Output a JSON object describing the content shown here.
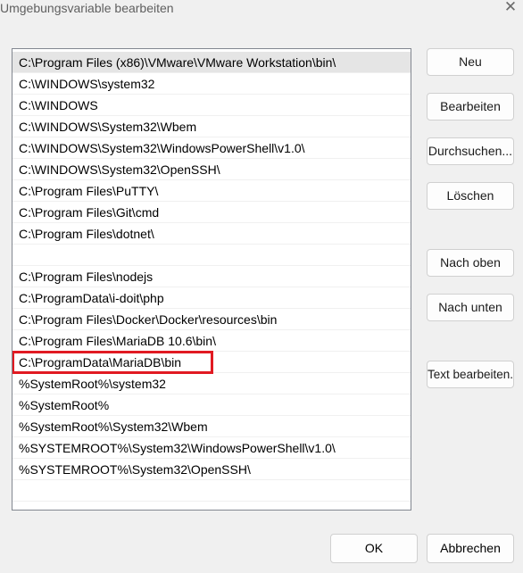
{
  "window": {
    "title": "Umgebungsvariable bearbeiten",
    "close_glyph": "✕"
  },
  "list": {
    "items": [
      "C:\\Program Files (x86)\\VMware\\VMware Workstation\\bin\\",
      "C:\\WINDOWS\\system32",
      "C:\\WINDOWS",
      "C:\\WINDOWS\\System32\\Wbem",
      "C:\\WINDOWS\\System32\\WindowsPowerShell\\v1.0\\",
      "C:\\WINDOWS\\System32\\OpenSSH\\",
      "C:\\Program Files\\PuTTY\\",
      "C:\\Program Files\\Git\\cmd",
      "C:\\Program Files\\dotnet\\",
      "",
      "C:\\Program Files\\nodejs",
      "C:\\ProgramData\\i-doit\\php",
      "C:\\Program Files\\Docker\\Docker\\resources\\bin",
      "C:\\Program Files\\MariaDB 10.6\\bin\\",
      "C:\\ProgramData\\MariaDB\\bin",
      "%SystemRoot%\\system32",
      "%SystemRoot%",
      "%SystemRoot%\\System32\\Wbem",
      "%SYSTEMROOT%\\System32\\WindowsPowerShell\\v1.0\\",
      "%SYSTEMROOT%\\System32\\OpenSSH\\",
      ""
    ],
    "selected_index": 0,
    "highlighted_index": 14,
    "highlight_color": "#e11a22"
  },
  "buttons": {
    "neu": "Neu",
    "bearbeiten": "Bearbeiten",
    "durchsuchen": "Durchsuchen...",
    "loeschen": "Löschen",
    "nach_oben": "Nach oben",
    "nach_unten": "Nach unten",
    "text_bearbeiten": "Text bearbeiten...",
    "ok": "OK",
    "abbrechen": "Abbrechen"
  }
}
